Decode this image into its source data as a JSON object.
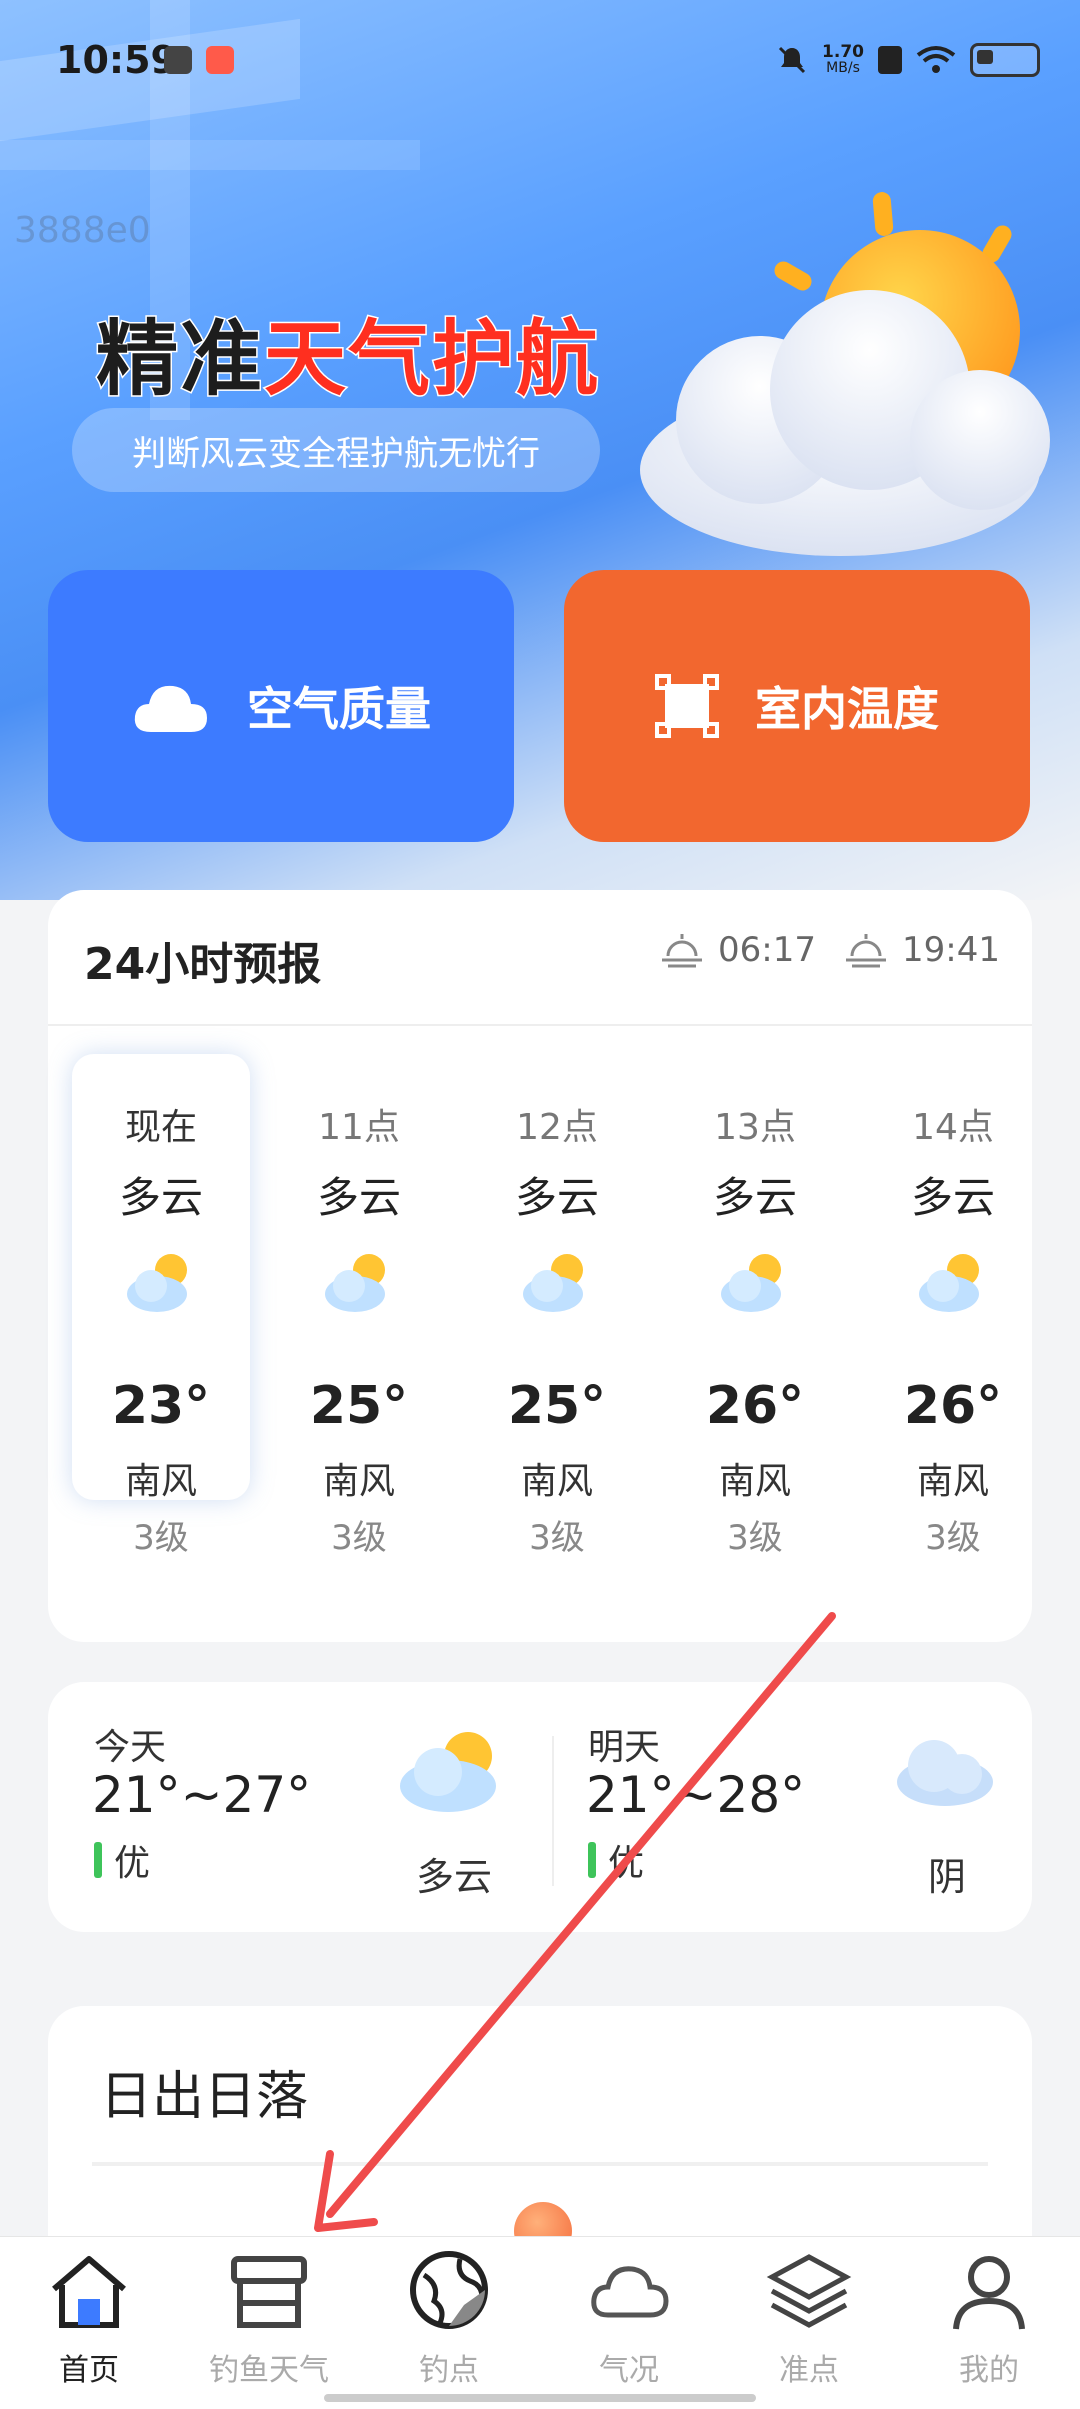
{
  "status_bar": {
    "time": "10:59",
    "net_speed": "1.70",
    "net_unit": "MB/s"
  },
  "watermark": "3888e0",
  "banner": {
    "title_part1": "精准",
    "title_part2": "天气护航",
    "subtitle": "判断风云变全程护航无忧行"
  },
  "actions": [
    {
      "label": "空气质量",
      "icon": "cloud-icon",
      "color": "#3d7bff"
    },
    {
      "label": "室内温度",
      "icon": "frame-icon",
      "color": "#f2672f"
    }
  ],
  "forecast": {
    "title": "24小时预报",
    "sunrise": "06:17",
    "sunset": "19:41",
    "hours": [
      {
        "label": "现在",
        "cond": "多云",
        "temp": "23°",
        "wind": "南风",
        "level": "3级"
      },
      {
        "label": "11点",
        "cond": "多云",
        "temp": "25°",
        "wind": "南风",
        "level": "3级"
      },
      {
        "label": "12点",
        "cond": "多云",
        "temp": "25°",
        "wind": "南风",
        "level": "3级"
      },
      {
        "label": "13点",
        "cond": "多云",
        "temp": "26°",
        "wind": "南风",
        "level": "3级"
      },
      {
        "label": "14点",
        "cond": "多云",
        "temp": "26°",
        "wind": "南风",
        "level": "3级"
      }
    ]
  },
  "days": [
    {
      "label": "今天",
      "range": "21°~27°",
      "aqi": "优",
      "cond": "多云",
      "icon": "partly-cloudy-icon"
    },
    {
      "label": "明天",
      "range": "21°~28°",
      "aqi": "优",
      "cond": "阴",
      "icon": "overcast-icon"
    }
  ],
  "sunrise_card": {
    "title": "日出日落"
  },
  "nav": [
    {
      "label": "首页",
      "icon": "home-icon",
      "active": true
    },
    {
      "label": "钓鱼天气",
      "icon": "shop-icon",
      "active": false
    },
    {
      "label": "钓点",
      "icon": "globe-icon",
      "active": false
    },
    {
      "label": "气况",
      "icon": "cloud-icon",
      "active": false
    },
    {
      "label": "准点",
      "icon": "layers-icon",
      "active": false
    },
    {
      "label": "我的",
      "icon": "user-icon",
      "active": false
    }
  ]
}
